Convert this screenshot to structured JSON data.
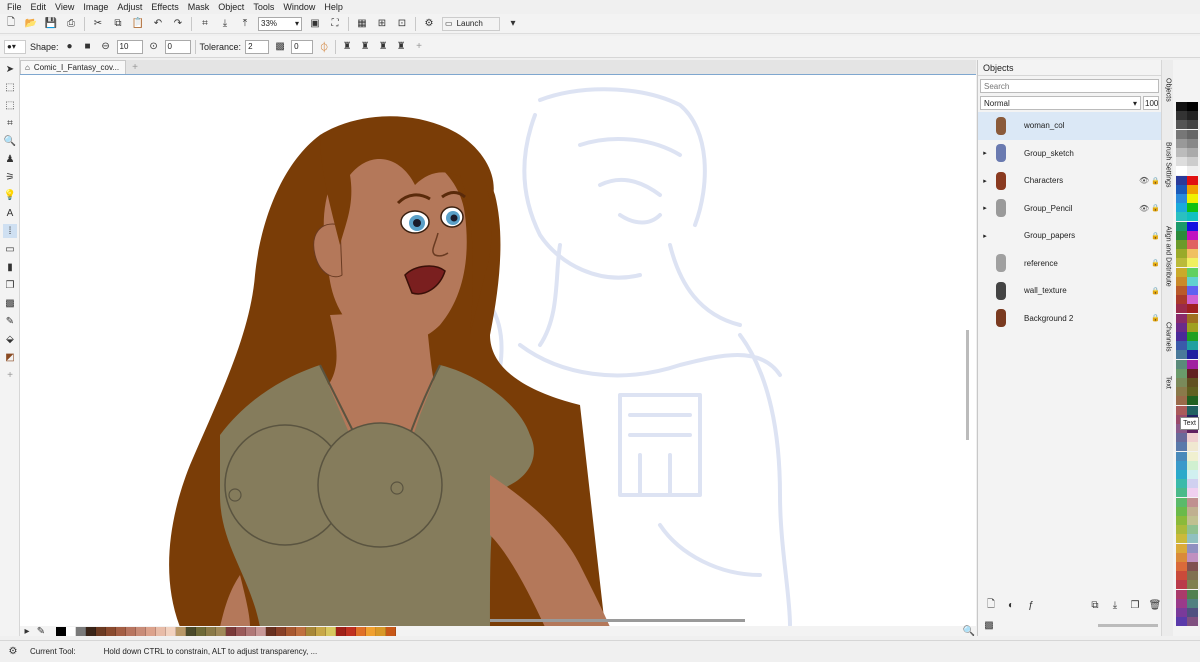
{
  "menu": [
    "File",
    "Edit",
    "View",
    "Image",
    "Adjust",
    "Effects",
    "Mask",
    "Object",
    "Tools",
    "Window",
    "Help"
  ],
  "toolbar": {
    "zoom": "33%",
    "launch_label": "Launch"
  },
  "propbar": {
    "shape_label": "Shape:",
    "size_value": "10",
    "angle_value": "0",
    "tolerance_label": "Tolerance:",
    "tolerance_value": "2",
    "transparency_value": "0"
  },
  "document": {
    "tab_title": "Comic_I_Fantasy_cov..."
  },
  "objects_panel": {
    "title": "Objects",
    "search_placeholder": "Search",
    "blend_mode": "Normal",
    "opacity": "100",
    "layers": [
      {
        "name": "woman_col",
        "selected": true,
        "expandable": false,
        "visible_icon": false,
        "locked": false
      },
      {
        "name": "Group_sketch",
        "selected": false,
        "expandable": true,
        "visible_icon": false,
        "locked": false
      },
      {
        "name": "Characters",
        "selected": false,
        "expandable": true,
        "visible_icon": true,
        "locked": true
      },
      {
        "name": "Group_Pencil",
        "selected": false,
        "expandable": true,
        "visible_icon": true,
        "locked": true
      },
      {
        "name": "Group_papers",
        "selected": false,
        "expandable": true,
        "visible_icon": false,
        "locked": true
      },
      {
        "name": "reference",
        "selected": false,
        "expandable": false,
        "visible_icon": false,
        "locked": true
      },
      {
        "name": "wall_texture",
        "selected": false,
        "expandable": false,
        "visible_icon": false,
        "locked": true
      },
      {
        "name": "Background 2",
        "selected": false,
        "expandable": false,
        "visible_icon": false,
        "locked": true
      }
    ]
  },
  "side_tabs": [
    "Objects",
    "Brush Settings",
    "Align and Distribute",
    "Channels",
    "Text"
  ],
  "tooltip": "Text",
  "status": {
    "label": "Current Tool:",
    "message": "Hold down CTRL to constrain, ALT to adjust transparency, ..."
  },
  "bottom_palette": [
    "#000000",
    "#ffffff",
    "#7a7a7a",
    "#3a2418",
    "#6b3a22",
    "#8a4a2e",
    "#a45e44",
    "#b87560",
    "#c98c78",
    "#dca28c",
    "#e8bca8",
    "#f2d2c0",
    "#b89868",
    "#4a4a2a",
    "#6e6a38",
    "#8a7a48",
    "#a08a5a",
    "#7a3a3a",
    "#9a5a5a",
    "#b07878",
    "#c89898",
    "#683020",
    "#884028",
    "#a85830",
    "#c07040",
    "#a88838",
    "#c8a848",
    "#d8c860",
    "#a02018",
    "#c03020",
    "#e07028",
    "#f0a030",
    "#d89828",
    "#c85818"
  ],
  "colors": {
    "hair": "#7a3d07",
    "skin": "#b4785a",
    "shirt": "#857c5c",
    "sketch": "#dde3f3",
    "selected_row": "#dbe8f6"
  }
}
